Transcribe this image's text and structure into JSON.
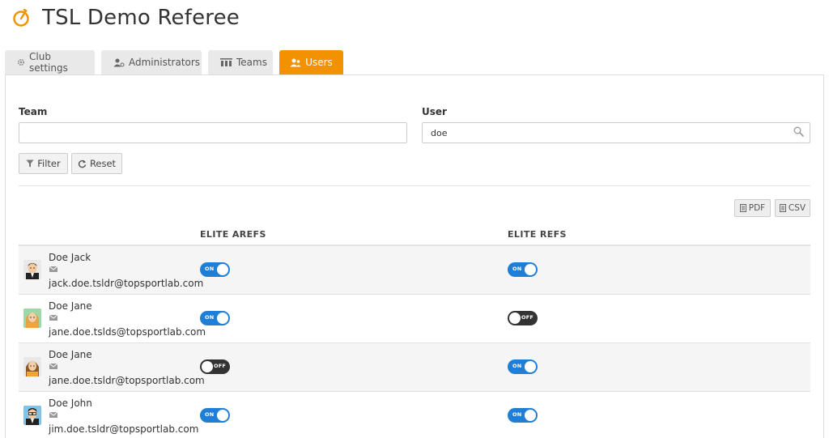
{
  "app": {
    "title": "TSL Demo Referee",
    "logo_icon": "stopwatch-icon",
    "accent_color": "#f39200"
  },
  "tabs": [
    {
      "label": "Club settings",
      "icon": "gear-icon",
      "active": false
    },
    {
      "label": "Administrators",
      "icon": "admin-users-icon",
      "active": false
    },
    {
      "label": "Teams",
      "icon": "teams-icon",
      "active": false
    },
    {
      "label": "Users",
      "icon": "users-icon",
      "active": true
    }
  ],
  "filters": {
    "team_label": "Team",
    "team_value": "",
    "user_label": "User",
    "user_value": "doe",
    "filter_button": "Filter",
    "reset_button": "Reset"
  },
  "export": {
    "pdf": "PDF",
    "csv": "CSV"
  },
  "table": {
    "columns": [
      "ELITE AREFS",
      "ELITE REFS"
    ],
    "rows": [
      {
        "name": "Doe Jack",
        "email": "jack.doe.tsldr@topsportlab.com",
        "elite_arefs": "ON",
        "elite_refs": "ON"
      },
      {
        "name": "Doe Jane",
        "email": "jane.doe.tslds@topsportlab.com",
        "elite_arefs": "ON",
        "elite_refs": "OFF"
      },
      {
        "name": "Doe Jane",
        "email": "jane.doe.tsldr@topsportlab.com",
        "elite_arefs": "OFF",
        "elite_refs": "ON"
      },
      {
        "name": "Doe John",
        "email": "jim.doe.tsldr@topsportlab.com",
        "elite_arefs": "ON",
        "elite_refs": "ON"
      }
    ]
  },
  "colors": {
    "toggle_on": "#1f7fd6",
    "toggle_off": "#333333"
  }
}
